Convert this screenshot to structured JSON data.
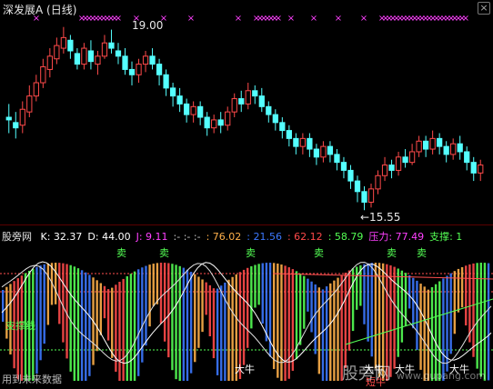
{
  "top": {
    "title": "深发展A",
    "period": "(日线)",
    "high_label": "19.00",
    "low_label": "←15.55",
    "close_symbol": "×",
    "candles": [
      [
        17.3,
        17.25,
        17.55,
        17.0
      ],
      [
        17.2,
        17.1,
        17.4,
        16.9
      ],
      [
        17.15,
        17.45,
        17.6,
        17.0
      ],
      [
        17.4,
        17.7,
        17.9,
        17.3
      ],
      [
        17.7,
        17.95,
        18.1,
        17.6
      ],
      [
        17.95,
        18.25,
        18.4,
        17.85
      ],
      [
        18.2,
        18.45,
        18.6,
        18.05
      ],
      [
        18.4,
        18.65,
        18.8,
        18.3
      ],
      [
        18.6,
        18.8,
        19.0,
        18.5
      ],
      [
        18.75,
        18.55,
        18.85,
        18.4
      ],
      [
        18.5,
        18.3,
        18.6,
        18.2
      ],
      [
        18.3,
        18.6,
        18.7,
        18.2
      ],
      [
        18.55,
        18.35,
        18.75,
        18.2
      ],
      [
        18.3,
        18.45,
        18.55,
        18.1
      ],
      [
        18.45,
        18.7,
        18.85,
        18.4
      ],
      [
        18.7,
        18.6,
        18.95,
        18.5
      ],
      [
        18.55,
        18.45,
        18.7,
        18.3
      ],
      [
        18.45,
        18.2,
        18.6,
        18.1
      ],
      [
        18.2,
        18.1,
        18.35,
        17.9
      ],
      [
        18.1,
        18.3,
        18.4,
        17.95
      ],
      [
        18.3,
        18.45,
        18.55,
        18.15
      ],
      [
        18.45,
        18.3,
        18.6,
        18.2
      ],
      [
        18.3,
        18.1,
        18.4,
        17.9
      ],
      [
        18.1,
        17.85,
        18.2,
        17.7
      ],
      [
        17.85,
        17.7,
        17.95,
        17.5
      ],
      [
        17.7,
        17.55,
        17.85,
        17.4
      ],
      [
        17.55,
        17.35,
        17.65,
        17.2
      ],
      [
        17.35,
        17.5,
        17.6,
        17.2
      ],
      [
        17.5,
        17.3,
        17.6,
        17.15
      ],
      [
        17.3,
        17.1,
        17.4,
        16.95
      ],
      [
        17.1,
        17.25,
        17.35,
        17.0
      ],
      [
        17.25,
        17.15,
        17.4,
        17.0
      ],
      [
        17.15,
        17.4,
        17.5,
        17.05
      ],
      [
        17.4,
        17.65,
        17.75,
        17.3
      ],
      [
        17.65,
        17.55,
        17.8,
        17.4
      ],
      [
        17.55,
        17.8,
        17.95,
        17.45
      ],
      [
        17.8,
        17.7,
        17.9,
        17.55
      ],
      [
        17.7,
        17.5,
        17.85,
        17.4
      ],
      [
        17.5,
        17.35,
        17.6,
        17.2
      ],
      [
        17.35,
        17.2,
        17.45,
        17.05
      ],
      [
        17.2,
        17.05,
        17.3,
        16.9
      ],
      [
        17.05,
        16.9,
        17.15,
        16.75
      ],
      [
        16.9,
        16.75,
        17.0,
        16.6
      ],
      [
        16.75,
        16.9,
        17.0,
        16.6
      ],
      [
        16.9,
        16.7,
        17.0,
        16.55
      ],
      [
        16.7,
        16.55,
        16.8,
        16.4
      ],
      [
        16.55,
        16.75,
        16.85,
        16.45
      ],
      [
        16.75,
        16.6,
        16.85,
        16.45
      ],
      [
        16.6,
        16.45,
        16.7,
        16.3
      ],
      [
        16.45,
        16.3,
        16.55,
        16.15
      ],
      [
        16.3,
        16.1,
        16.4,
        15.95
      ],
      [
        16.1,
        15.9,
        16.2,
        15.7
      ],
      [
        15.9,
        15.7,
        16.0,
        15.55
      ],
      [
        15.7,
        15.95,
        16.05,
        15.6
      ],
      [
        15.95,
        16.2,
        16.3,
        15.85
      ],
      [
        16.2,
        16.4,
        16.55,
        16.1
      ],
      [
        16.4,
        16.3,
        16.5,
        16.15
      ],
      [
        16.3,
        16.55,
        16.65,
        16.2
      ],
      [
        16.55,
        16.45,
        16.7,
        16.35
      ],
      [
        16.45,
        16.65,
        16.8,
        16.4
      ],
      [
        16.65,
        16.85,
        16.95,
        16.55
      ],
      [
        16.85,
        16.7,
        16.95,
        16.55
      ],
      [
        16.7,
        16.9,
        17.05,
        16.6
      ],
      [
        16.9,
        16.75,
        17.0,
        16.6
      ],
      [
        16.75,
        16.6,
        16.85,
        16.45
      ],
      [
        16.6,
        16.8,
        16.9,
        16.5
      ],
      [
        16.8,
        16.65,
        16.95,
        16.5
      ],
      [
        16.65,
        16.45,
        16.75,
        16.3
      ],
      [
        16.45,
        16.25,
        16.55,
        16.1
      ],
      [
        16.25,
        16.4,
        16.5,
        16.1
      ]
    ],
    "signal_marks": [
      "×",
      "×",
      "×",
      "×",
      "×",
      "×",
      "×",
      "×",
      "×",
      "×",
      "×",
      "×",
      "×",
      "×",
      "×",
      "×",
      "×",
      "×",
      "×",
      "×",
      "×",
      "×",
      "×",
      "×",
      "×",
      "×",
      "×",
      "×",
      "×",
      "×",
      "×",
      "×",
      "×",
      "×",
      "×",
      "×",
      "×",
      "×",
      "×",
      "×",
      "×",
      "×",
      "×",
      "×",
      "×",
      "×",
      "×",
      "×",
      "×",
      "×",
      "×"
    ],
    "price_range": [
      15.4,
      19.2
    ],
    "colors": {
      "up": "#ff4a4a",
      "down": "#54ffff",
      "marks": "#ff40ff"
    }
  },
  "indicator": {
    "source": "股旁网",
    "values": [
      {
        "text": "K: 32.37",
        "color": "#ffffff"
      },
      {
        "text": "D: 44.00",
        "color": "#ffffff"
      },
      {
        "text": "J: 9.11",
        "color": "#ff40ff"
      },
      {
        "text": ":-  :-  :-",
        "color": "#c8c8c8"
      },
      {
        "text": ": 76.02",
        "color": "#ffb04a"
      },
      {
        "text": ": 21.56",
        "color": "#3c78ff"
      },
      {
        "text": ": 62.12",
        "color": "#ff4a4a"
      },
      {
        "text": ": 58.79",
        "color": "#54ff54"
      },
      {
        "text": "压力: 77.49",
        "color": "#ff40ff"
      },
      {
        "text": "支撑: 1",
        "color": "#54ff54"
      }
    ],
    "sell_labels": [
      "卖",
      "卖",
      "卖",
      "卖",
      "卖",
      "卖"
    ],
    "support_label": "支撑线",
    "bull_labels": [
      "大牛",
      "大牛",
      "大牛",
      "大牛"
    ],
    "short_bull_label": "短牛",
    "footnote": "用到未来数据",
    "watermark": "股旁网",
    "watermark_url": "www.gupang.com",
    "colors": {
      "sell": "#54ff54",
      "support": "#54ff54",
      "bull": "#ffffff",
      "short_bull": "#ff4a4a"
    }
  }
}
